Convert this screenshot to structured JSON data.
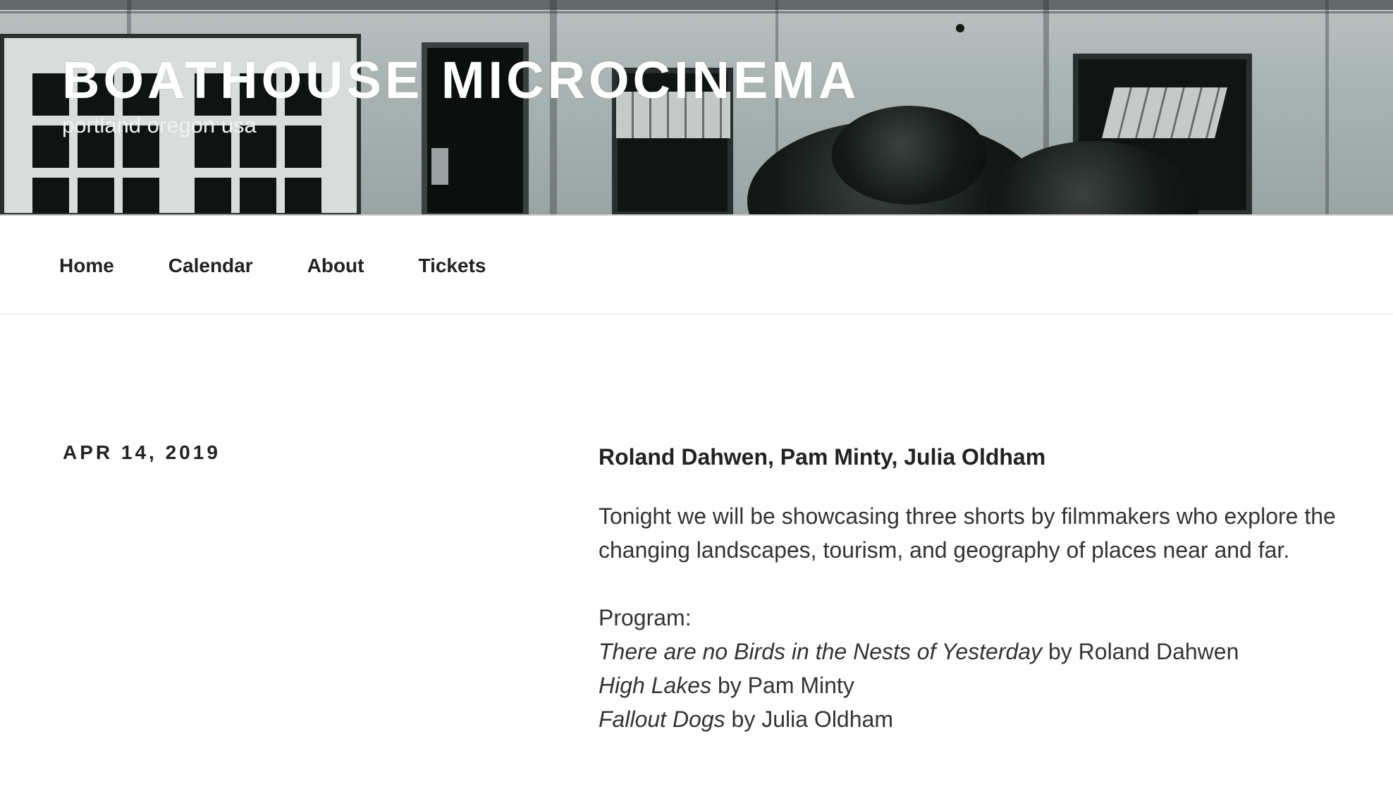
{
  "site": {
    "title": "BOATHOUSE MICROCINEMA",
    "description": "portland oregon usa"
  },
  "nav": {
    "items": [
      {
        "label": "Home"
      },
      {
        "label": "Calendar"
      },
      {
        "label": "About"
      },
      {
        "label": "Tickets"
      }
    ]
  },
  "post": {
    "date": "APR 14, 2019",
    "title": "Roland Dahwen, Pam Minty, Julia Oldham",
    "intro": "Tonight we will be showcasing three shorts by filmmakers who explore the changing landscapes, tourism, and geography of places near and far.",
    "program_label": "Program:",
    "program": [
      {
        "film": "There are no Birds in the Nests of Yesterday",
        "credit": " by Roland Dahwen"
      },
      {
        "film": "High Lakes",
        "credit": " by Pam Minty"
      },
      {
        "film": "Fallout Dogs",
        "credit": " by Julia Oldham"
      }
    ]
  },
  "colors": {
    "text": "#222222",
    "body_text": "#333333",
    "header_title": "#ffffff"
  }
}
